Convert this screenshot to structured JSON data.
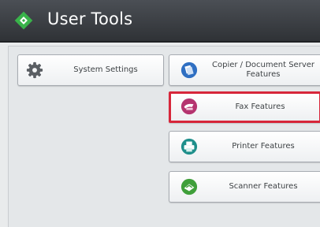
{
  "header": {
    "title": "User Tools",
    "icon": "user-tools-diamond-icon",
    "accent": "#39b34a"
  },
  "buttons": {
    "system_settings": {
      "label": "System Settings",
      "icon": "gear-icon"
    },
    "copier": {
      "label": "Copier / Document Server Features",
      "icon": "copier-document-icon",
      "color": "#2f6fc2"
    },
    "fax": {
      "label": "Fax Features",
      "icon": "fax-icon",
      "color": "#b5346f",
      "highlight": "#d7263a"
    },
    "printer": {
      "label": "Printer Features",
      "icon": "printer-icon",
      "color": "#1f8f8b"
    },
    "scanner": {
      "label": "Scanner Features",
      "icon": "scanner-icon",
      "color": "#3f9f3a"
    }
  }
}
